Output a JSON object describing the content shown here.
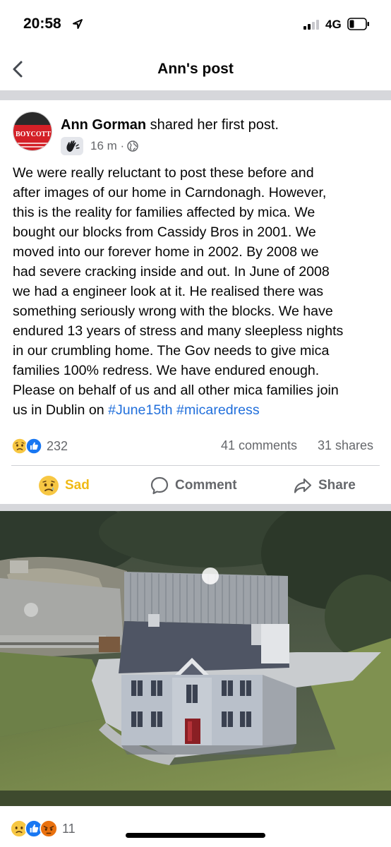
{
  "status": {
    "time": "20:58",
    "network": "4G"
  },
  "nav": {
    "title": "Ann's post",
    "back_icon": "chevron-left-icon"
  },
  "post": {
    "author": "Ann Gorman",
    "action_text": " shared her first post.",
    "avatar_text": "BOYCOTT",
    "time": "16 m ·",
    "audience_icon": "globe-icon",
    "badge_icon": "new-member-wave-icon",
    "body_lines": [
      "We were really reluctant to post these before and",
      "after images of our home in Carndonagh. However,",
      "this is the reality for families affected by mica. We",
      "bought our blocks from Cassidy Bros in 2001. We",
      "moved into our forever home in 2002. By 2008  we",
      "had severe cracking inside and out. In June of 2008",
      "we had a engineer look at it. He realised there was",
      "something seriously wrong with the blocks. We have",
      "endured 13 years of stress and many sleepless nights",
      "in our crumbling home. The Gov needs to give mica",
      "families 100% redress. We have endured enough.",
      "Please on behalf of us and all other mica families join"
    ],
    "last_line_prefix": "us in Dublin on ",
    "hashtags": [
      "#June15th",
      "#micaredress"
    ],
    "reaction_count": "232",
    "comments": "41 comments",
    "shares": "31 shares"
  },
  "actions": {
    "sad": "Sad",
    "comment": "Comment",
    "share": "Share"
  },
  "photo": {
    "reaction_count": "11"
  },
  "colors": {
    "link": "#216fdb",
    "secondary_text": "#65676b",
    "sad_yellow": "#f0ba15",
    "like_blue": "#1877f2",
    "angry_orange": "#e9710f"
  }
}
